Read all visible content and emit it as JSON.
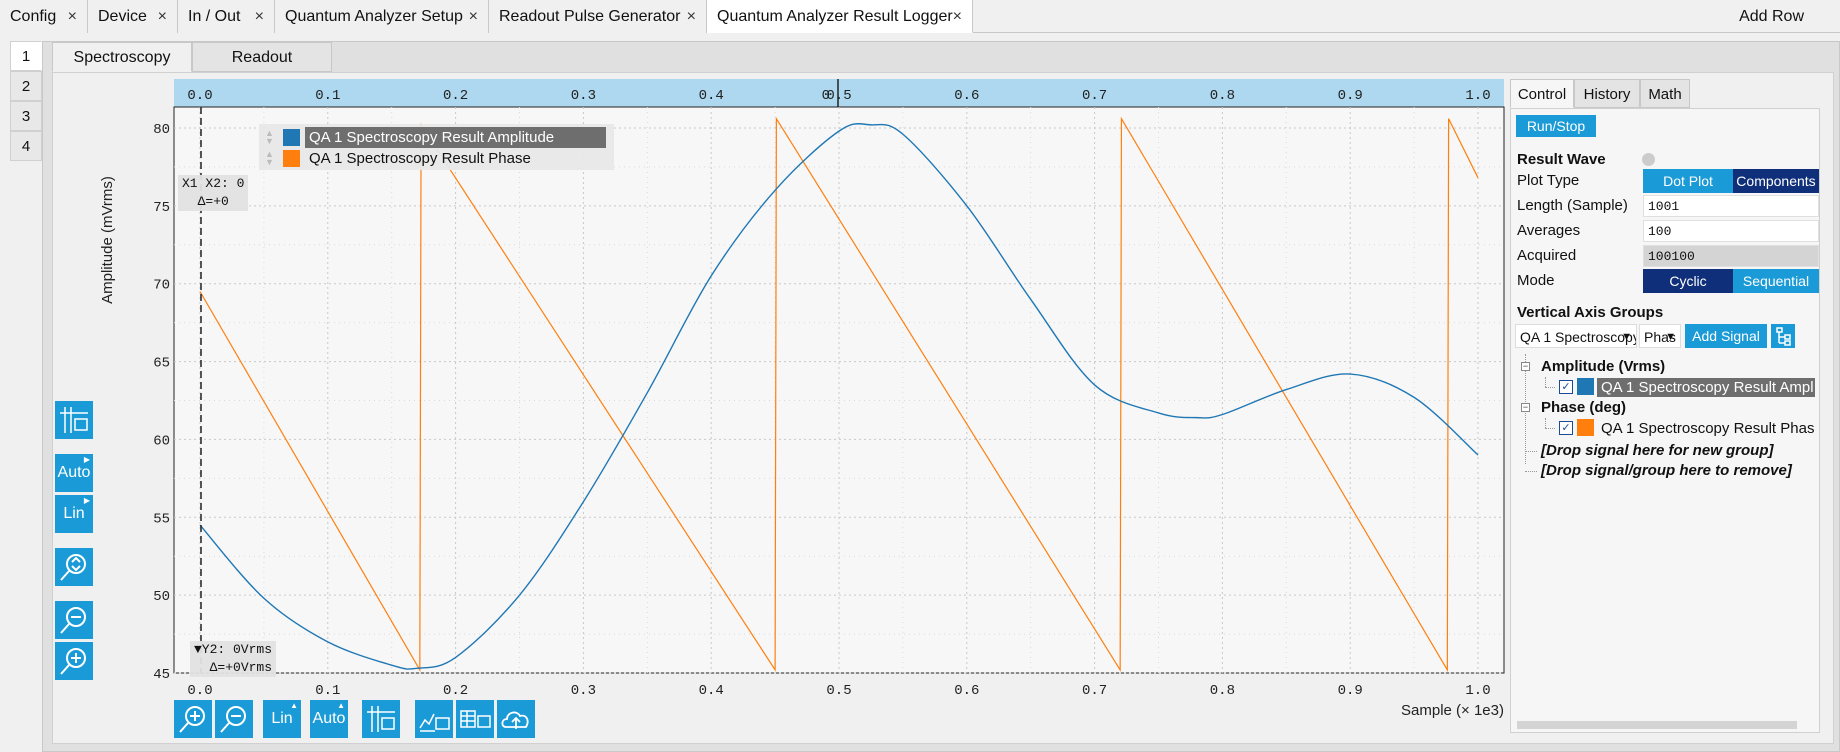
{
  "top_tabs": [
    {
      "label": "Config"
    },
    {
      "label": "Device"
    },
    {
      "label": "In / Out"
    },
    {
      "label": "Quantum Analyzer Setup"
    },
    {
      "label": "Readout Pulse Generator"
    },
    {
      "label": "Quantum Analyzer Result Logger"
    }
  ],
  "top_tab_close": "×",
  "add_row": "Add Row",
  "row_tabs": [
    "1",
    "2",
    "3",
    "4"
  ],
  "sub_tabs": [
    "Spectroscopy",
    "Readout"
  ],
  "plot": {
    "ylabel": "Amplitude (mVrms)",
    "xlabel": "Sample (× 1e3)",
    "x_ticks": [
      "0.0",
      "0.1",
      "0.2",
      "0.3",
      "0.4",
      "0.5",
      "0.6",
      "0.7",
      "0.8",
      "0.9",
      "1.0"
    ],
    "y_ticks": [
      "80",
      "75",
      "70",
      "65",
      "60",
      "55",
      "50",
      "45"
    ],
    "top_marker_label": "0",
    "cursor_x": {
      "line1": "X1 X2: 0",
      "line2": "Δ=+0"
    },
    "cursor_y": {
      "line1": "▼Y2: 0Vrms",
      "line2": "Δ=+0Vrms"
    }
  },
  "legend": [
    {
      "label": "QA 1 Spectroscopy Result Amplitude",
      "color": "#1f77b4",
      "selected": true
    },
    {
      "label": "QA 1 Spectroscopy Result Phase",
      "color": "#ff7f0e",
      "selected": false
    }
  ],
  "chart_data": {
    "type": "line",
    "xlabel": "Sample (× 1e3)",
    "ylabel": "Amplitude (mVrms)",
    "xlim": [
      0.0,
      1.0
    ],
    "ylim": [
      45,
      80
    ],
    "grid": true,
    "series": [
      {
        "name": "QA 1 Spectroscopy Result Amplitude",
        "color": "#1f77b4",
        "x": [
          0.0,
          0.05,
          0.1,
          0.15,
          0.17,
          0.2,
          0.25,
          0.3,
          0.35,
          0.4,
          0.45,
          0.5,
          0.525,
          0.55,
          0.6,
          0.65,
          0.7,
          0.75,
          0.78,
          0.8,
          0.85,
          0.9,
          0.95,
          1.0
        ],
        "y": [
          54.5,
          49.8,
          47.0,
          45.5,
          45.3,
          46.0,
          50.0,
          56.0,
          63.0,
          70.5,
          76.0,
          79.8,
          80.2,
          79.6,
          75.0,
          69.0,
          63.5,
          61.7,
          61.4,
          61.6,
          63.2,
          64.2,
          62.7,
          59.0
        ]
      },
      {
        "name": "QA 1 Spectroscopy Result Phase",
        "color": "#ff7f0e",
        "x": [
          0.0,
          0.172,
          0.173,
          0.45,
          0.451,
          0.72,
          0.721,
          0.976,
          0.977,
          1.0
        ],
        "y": [
          69.5,
          45.2,
          80.2,
          45.2,
          80.6,
          45.2,
          80.6,
          45.2,
          80.6,
          76.8
        ]
      }
    ]
  },
  "left_tools": [
    {
      "name": "cursor-tool-button",
      "label": "",
      "icon": "cursor-icon"
    },
    {
      "name": "auto-scale-y-button",
      "label": "Auto"
    },
    {
      "name": "lin-scale-y-button",
      "label": "Lin"
    },
    {
      "name": "zoom-fit-y-button",
      "label": "",
      "icon": "zoom-fit-icon"
    },
    {
      "name": "zoom-out-y-button",
      "label": "",
      "icon": "zoom-out-icon"
    },
    {
      "name": "zoom-in-y-button",
      "label": "",
      "icon": "zoom-in-icon"
    }
  ],
  "bottom_tools": [
    {
      "name": "zoom-in-x-button",
      "label": "",
      "icon": "zoom-in-icon"
    },
    {
      "name": "zoom-out-x-button",
      "label": "",
      "icon": "zoom-out-icon"
    },
    {
      "name": "lin-scale-x-button",
      "label": "Lin"
    },
    {
      "name": "auto-scale-x-button",
      "label": "Auto"
    },
    {
      "name": "cursor-x-button",
      "label": "",
      "icon": "cursor-icon"
    },
    {
      "name": "math-tool-button",
      "label": "",
      "icon": "math-icon"
    },
    {
      "name": "table-tool-button",
      "label": "",
      "icon": "table-icon"
    },
    {
      "name": "upload-button",
      "label": "",
      "icon": "cloud-upload-icon"
    }
  ],
  "control": {
    "tabs": [
      "Control",
      "History",
      "Math"
    ],
    "run_stop": "Run/Stop",
    "result_wave": "Result Wave",
    "plot_type_label": "Plot Type",
    "plot_type_options": [
      "Dot Plot",
      "Components"
    ],
    "length_label": "Length (Sample)",
    "length_value": "1001",
    "averages_label": "Averages",
    "averages_value": "100",
    "acquired_label": "Acquired",
    "acquired_value": "100100",
    "mode_label": "Mode",
    "mode_options": [
      "Cyclic",
      "Sequential"
    ],
    "vag_title": "Vertical Axis Groups",
    "signal_select": "QA 1 Spectroscopy",
    "signal_sub_select": "Phas",
    "add_signal": "Add Signal",
    "groups": [
      {
        "title": "Amplitude (Vrms)",
        "signal": "QA 1 Spectroscopy Result Ampl",
        "color": "#1f77b4",
        "checked": "✓"
      },
      {
        "title": "Phase (deg)",
        "signal": "QA 1 Spectroscopy Result Phas",
        "color": "#ff7f0e",
        "checked": "✓"
      }
    ],
    "drop_new": "[Drop signal here for new group]",
    "drop_remove": "[Drop signal/group here to remove]"
  }
}
